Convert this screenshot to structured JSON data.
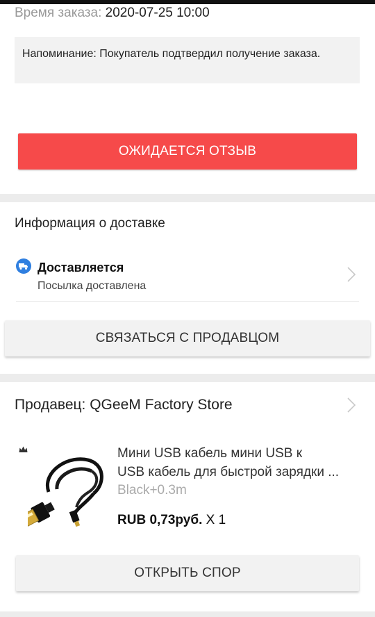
{
  "order": {
    "time_label": "Время заказа:",
    "time_value": "2020-07-25 10:00",
    "reminder": "Напоминание: Покупатель подтвердил получение заказа.",
    "review_button": "ОЖИДАЕТСЯ ОТЗЫВ"
  },
  "delivery": {
    "title": "Информация о доставке",
    "status": "Доставляется",
    "substatus": "Посылка доставлена",
    "contact_button": "СВЯЗАТЬСЯ С ПРОДАВЦОМ"
  },
  "seller": {
    "name": "Продавец: QGeeM Factory Store"
  },
  "product": {
    "title_line1": "Мини USB кабель мини USB к",
    "title_line2": "USB кабель для быстрой зарядки ...",
    "variant": "Black+0.3m",
    "price": "RUB 0,73руб.",
    "quantity": "X 1",
    "dispute_button": "ОТКРЫТЬ СПОР"
  },
  "colors": {
    "accent_red": "#f64a4a",
    "info_blue": "#2f7fe0"
  },
  "icons": [
    "truck-icon",
    "chevron-right-icon",
    "crown-icon"
  ]
}
